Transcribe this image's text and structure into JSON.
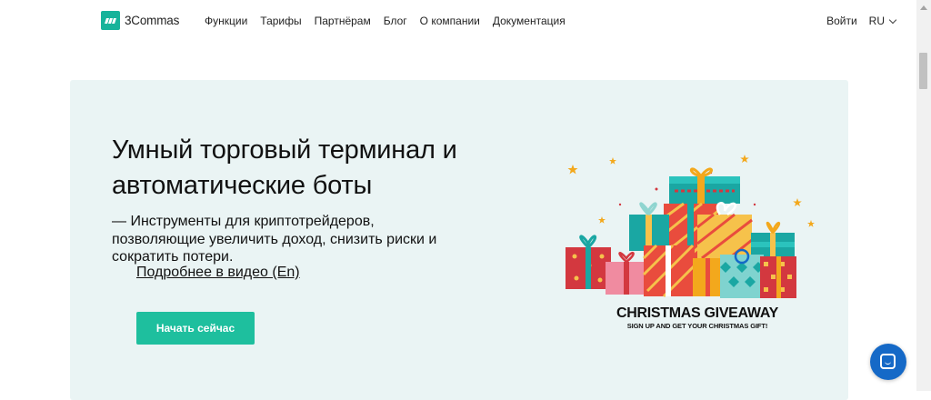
{
  "header": {
    "brand": "3Commas",
    "nav": [
      "Функции",
      "Тарифы",
      "Партнёрам",
      "Блог",
      "О компании",
      "Документация"
    ],
    "login": "Войти",
    "lang": "RU"
  },
  "hero": {
    "title": "Умный торговый терминал и автоматические боты",
    "description": "— Инструменты для криптотрейдеров, позволяющие увеличить доход, снизить риски и сократить потери.",
    "video_link": "Подробнее в видео (En)",
    "cta": "Начать сейчас"
  },
  "promo": {
    "title": "CHRISTMAS GIVEAWAY",
    "subtitle": "SIGN UP AND GET YOUR CHRISTMAS GIFT!"
  },
  "colors": {
    "brand": "#16b39a",
    "cta": "#1ebf9e",
    "hero_bg": "#eaf4f4",
    "chat": "#1569c7"
  }
}
